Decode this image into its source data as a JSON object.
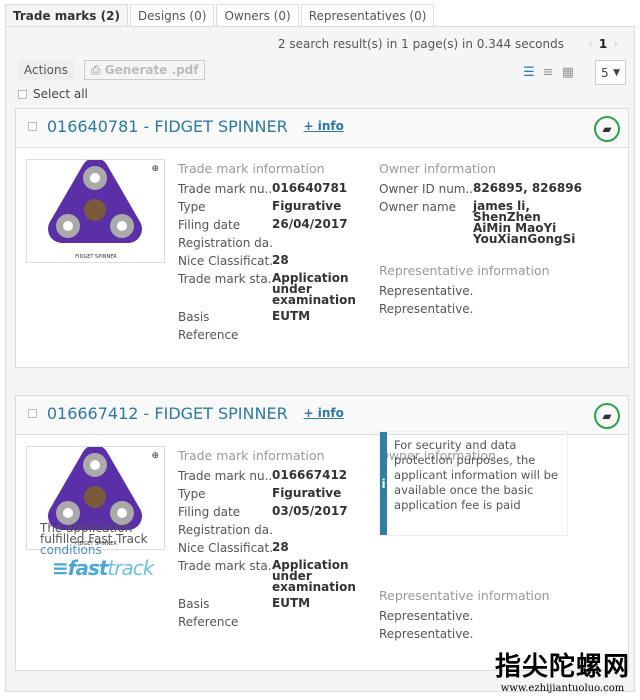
{
  "tabs": [
    {
      "label": "Trade marks (2)",
      "active": true
    },
    {
      "label": "Designs (0)"
    },
    {
      "label": "Owners (0)"
    },
    {
      "label": "Representatives (0)"
    }
  ],
  "toolbar": {
    "results": "2 search result(s) in 1 page(s) in 0.344 seconds",
    "page": "1",
    "actions": "Actions",
    "generate": "Generate .pdf",
    "per_page": "5",
    "select_all": "Select all",
    "view_icons": [
      "list-icon",
      "compact-list-icon",
      "grid-icon"
    ]
  },
  "labels": {
    "tm_info": "Trade mark information",
    "owner_info": "Owner information",
    "rep_info": "Representative information",
    "tm_number": "Trade mark nu...",
    "type": "Type",
    "filing": "Filing date",
    "registration": "Registration da...",
    "nice": "Nice Classificat...",
    "status": "Trade mark sta...",
    "basis": "Basis",
    "reference": "Reference",
    "owner_id": "Owner ID num...",
    "owner_name": "Owner name",
    "representative": "Representative...",
    "more_info": "+ info",
    "image_caption": "FIDGET SPINNER"
  },
  "cards": [
    {
      "title": "016640781 - FIDGET SPINNER",
      "number": "016640781",
      "type": "Figurative",
      "filing": "26/04/2017",
      "nice": "28",
      "status": "Application under examination",
      "basis": "EUTM",
      "owner_id": "826895, 826896",
      "owner_name": "james li, ShenZhen AiMin MaoYi YouXianGongSi"
    },
    {
      "title": "016667412 - FIDGET SPINNER",
      "number": "016667412",
      "type": "Figurative",
      "filing": "03/05/2017",
      "nice": "28",
      "status": "Application under examination",
      "basis": "EUTM",
      "notice": "For security and data protection purposes, the applicant information will be available once the basic application fee is paid",
      "fasttrack_text": "The application fulfilled Fast Track",
      "fasttrack_link": "conditions",
      "fasttrack_logo": "fast track"
    }
  ],
  "colors": {
    "link": "#2a79a8",
    "fold_ring": "#2aa54a",
    "notice_bar": "#2f7ea6"
  },
  "watermark": {
    "cn": "指尖陀螺网",
    "url": "www.ezhijiantuoluo.com"
  }
}
